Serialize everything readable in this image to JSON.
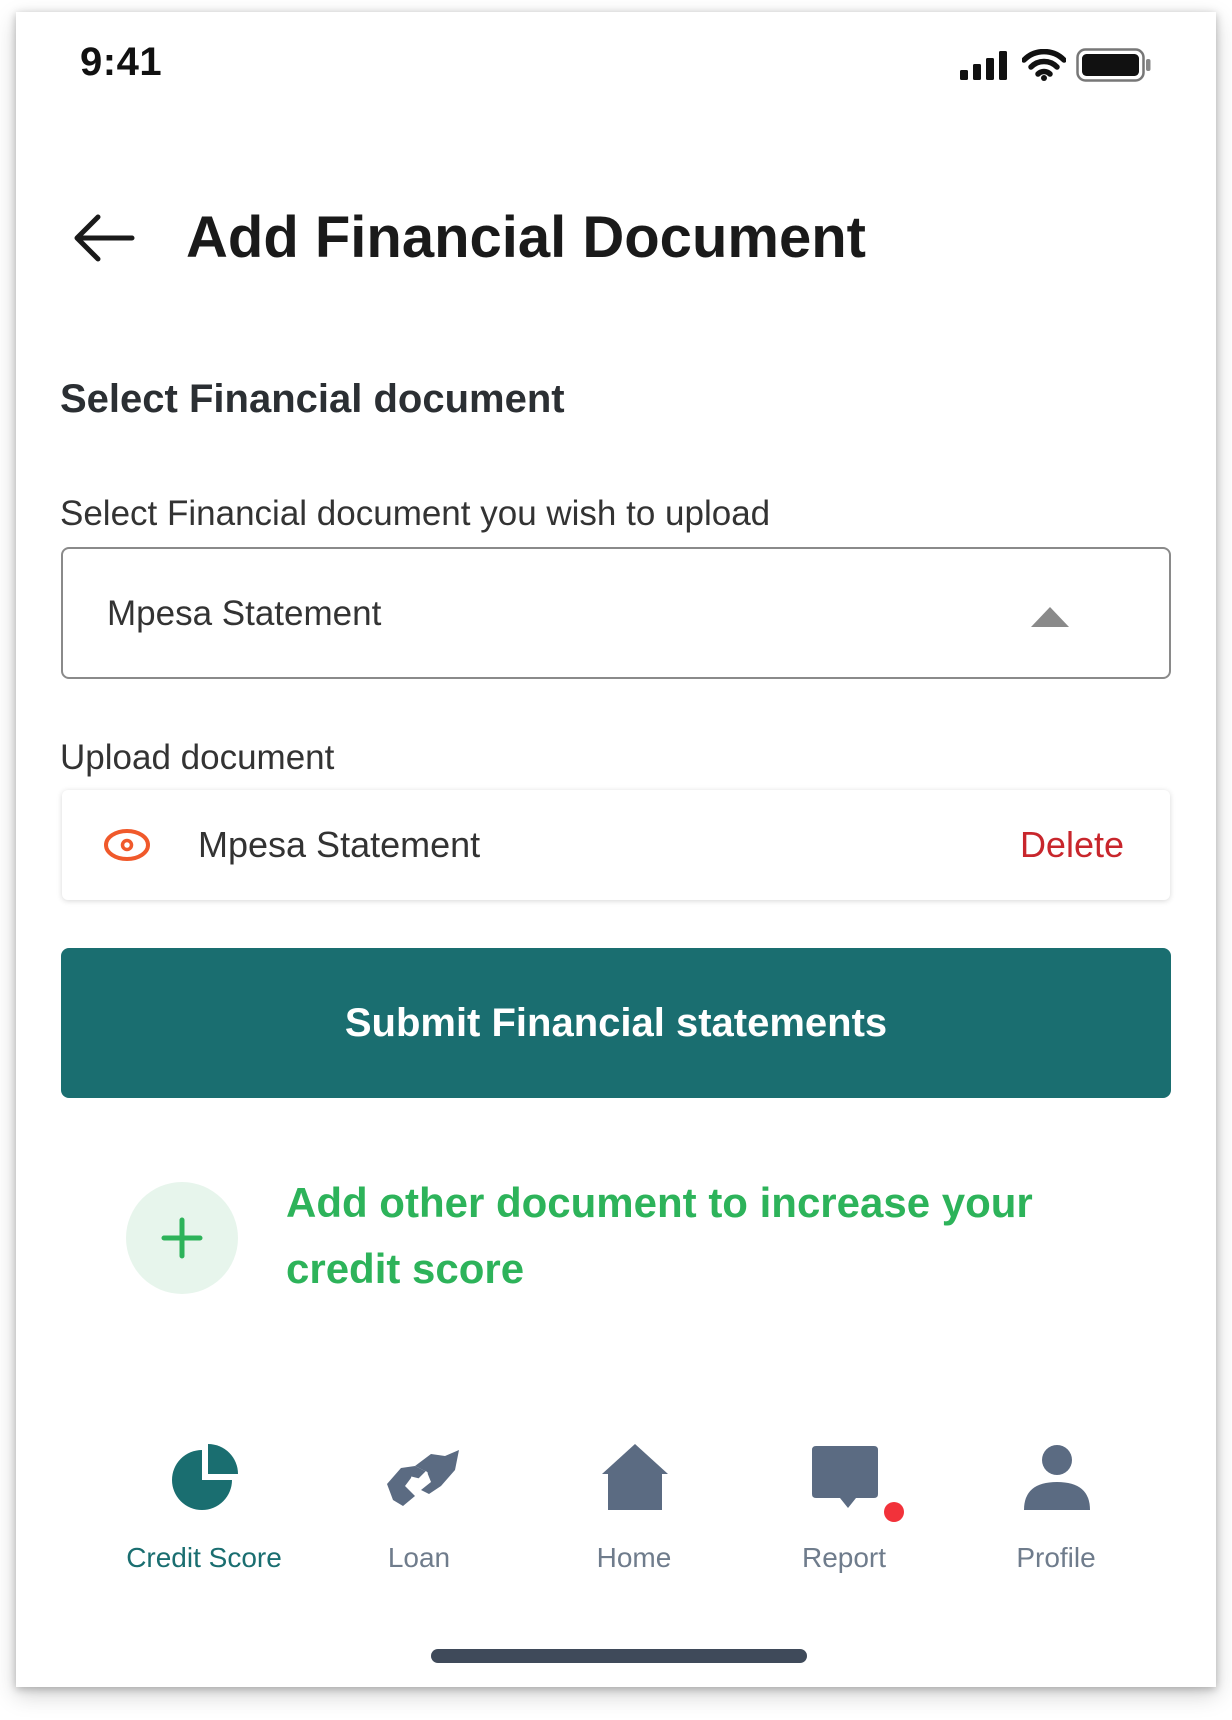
{
  "status_bar": {
    "time": "9:41",
    "icons": [
      "cellular-signal-icon",
      "wifi-icon",
      "battery-icon"
    ]
  },
  "header": {
    "back_icon": "arrow-left-icon",
    "title": "Add Financial Document"
  },
  "form": {
    "section_title": "Select Financial document",
    "select_label": "Select Financial document you wish to upload",
    "select_value": "Mpesa Statement",
    "select_icon": "caret-up-icon",
    "upload_label": "Upload document",
    "uploaded_file": {
      "icon": "eye-icon",
      "name": "Mpesa Statement",
      "delete_label": "Delete"
    },
    "submit_label": "Submit Financial statements",
    "add_other": {
      "icon": "plus-icon",
      "text": "Add other document to increase your credit score"
    }
  },
  "bottom_nav": {
    "items": [
      {
        "label": "Credit Score",
        "icon": "pie-chart-icon",
        "active": true
      },
      {
        "label": "Loan",
        "icon": "handshake-icon",
        "active": false
      },
      {
        "label": "Home",
        "icon": "home-icon",
        "active": false
      },
      {
        "label": "Report",
        "icon": "chat-bubble-icon",
        "active": false,
        "badge": true
      },
      {
        "label": "Profile",
        "icon": "user-icon",
        "active": false
      }
    ]
  },
  "colors": {
    "primary": "#1a6e70",
    "accent_green": "#2db35a",
    "delete_red": "#c8262c",
    "eye_orange": "#f0592b",
    "nav_inactive": "#5b6b82",
    "badge_red": "#f2323a"
  }
}
